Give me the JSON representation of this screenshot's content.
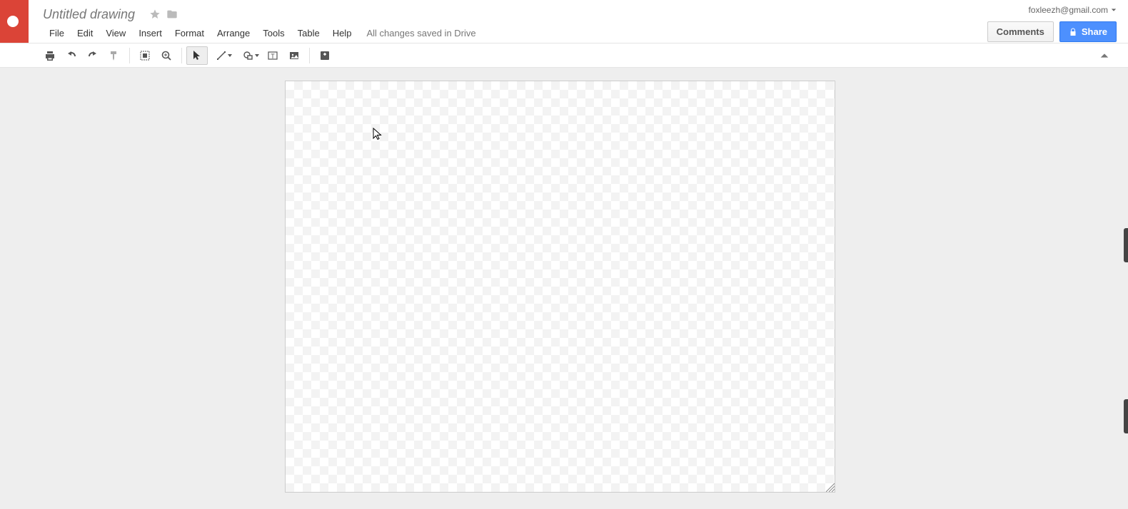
{
  "header": {
    "docTitle": "Untitled drawing",
    "menus": [
      "File",
      "Edit",
      "View",
      "Insert",
      "Format",
      "Arrange",
      "Tools",
      "Table",
      "Help"
    ],
    "saveStatus": "All changes saved in Drive",
    "commentsLabel": "Comments",
    "shareLabel": "Share",
    "accountEmail": "foxleezh@gmail.com"
  },
  "toolbar": {
    "tools": [
      {
        "name": "print-button",
        "group": 0,
        "dd": false,
        "active": false,
        "icon": "print"
      },
      {
        "name": "undo-button",
        "group": 0,
        "dd": false,
        "active": false,
        "icon": "undo"
      },
      {
        "name": "redo-button",
        "group": 0,
        "dd": false,
        "active": false,
        "icon": "redo"
      },
      {
        "name": "paint-format-button",
        "group": 0,
        "dd": false,
        "active": false,
        "icon": "paint"
      },
      {
        "name": "zoom-fit-button",
        "group": 1,
        "dd": false,
        "active": false,
        "icon": "fit"
      },
      {
        "name": "zoom-button",
        "group": 1,
        "dd": false,
        "active": false,
        "icon": "zoom"
      },
      {
        "name": "select-tool",
        "group": 2,
        "dd": false,
        "active": true,
        "icon": "cursor"
      },
      {
        "name": "line-tool",
        "group": 2,
        "dd": true,
        "active": false,
        "icon": "line"
      },
      {
        "name": "shape-tool",
        "group": 2,
        "dd": true,
        "active": false,
        "icon": "shape"
      },
      {
        "name": "textbox-tool",
        "group": 2,
        "dd": false,
        "active": false,
        "icon": "textbox"
      },
      {
        "name": "image-tool",
        "group": 2,
        "dd": false,
        "active": false,
        "icon": "image"
      },
      {
        "name": "insert-comment-button",
        "group": 3,
        "dd": false,
        "active": false,
        "icon": "comment"
      }
    ]
  }
}
